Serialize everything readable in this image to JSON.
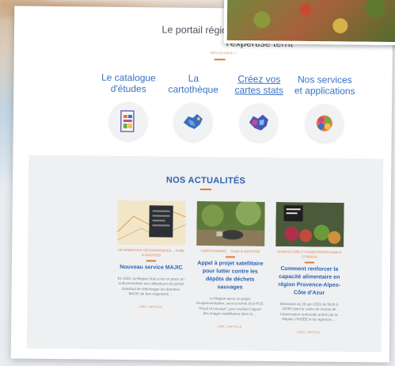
{
  "intro": {
    "line1": "Le portail régional dédié au partage d",
    "line2": "l'expertise territ",
    "link": "DÉCOUVRIR +"
  },
  "services": [
    {
      "title": "Le catalogue d'études",
      "icon": "document-icon"
    },
    {
      "title": "La cartothèque",
      "icon": "map-icon"
    },
    {
      "title": "Créez vos cartes stats",
      "icon": "map-stats-icon"
    },
    {
      "title": "Nos services et applications",
      "icon": "apps-icon"
    }
  ],
  "news": {
    "title": "NOS ACTUALITÉS",
    "cards": [
      {
        "category": "INFORMATIONS GÉOGRAPHIQUES ... Publié le 04/07/2022",
        "title": "Nouveau service MAJIC",
        "body": "En 2021, la Région Sud a mis en place un outil permettant aux utilisateurs du portail DataSud de télécharger les données MAJIC de leur organisme ...",
        "more": "LIRE L'ARTICLE"
      },
      {
        "category": "CARTOGRAPHIE ... Publié le 30/07/2022",
        "title": "Appel à projet satellitaire pour lutter contre les dépôts de déchets sauvages",
        "body": "La Région lance un projet d'expérimentation, sous la forme d'un POC \"Proof of concept\", pour évaluer l'apport des images satellitaires dans la ...",
        "more": "LIRE L'ARTICLE"
      },
      {
        "category": "AGRICULTURE ET ALIMENTATION Publié le 27/06/2022",
        "title": "Comment renforcer la capacité alimentaire en région Provence-Alpes-Côte d'Azur",
        "body": "Webinaire du 28 juin 2022 de 9h30 à 12h00 dans le cadre du réseau de l'observation territoriale animé par la Région, l'INSEE et les agences ...",
        "more": "LIRE L'ARTICLE"
      }
    ]
  }
}
